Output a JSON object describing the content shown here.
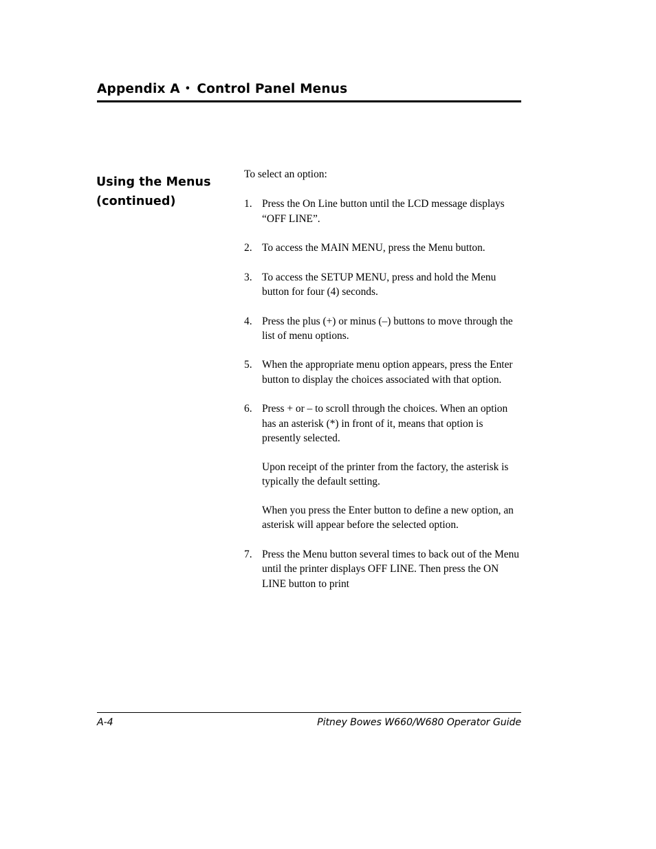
{
  "header": {
    "appendix_label": "Appendix A",
    "separator": "•",
    "title": "Control Panel Menus"
  },
  "sidebar": {
    "heading_line1": "Using the Menus",
    "heading_line2": "(continued)"
  },
  "main": {
    "lead_in": "To select an option:",
    "steps": [
      {
        "number": "1.",
        "text": "Press the On Line button until the LCD message displays “OFF LINE”."
      },
      {
        "number": "2.",
        "text": "To access the MAIN MENU, press the Menu button."
      },
      {
        "number": "3.",
        "text": "To access the SETUP MENU, press and hold the Menu button for four (4) seconds."
      },
      {
        "number": "4.",
        "text": "Press the plus (+) or minus (–) buttons to move through the list of menu options."
      },
      {
        "number": "5.",
        "text": "When the appropriate menu option appears, press the Enter button to display the choices associated with that option."
      },
      {
        "number": "6.",
        "text": "Press + or – to scroll through the choices. When an option has an asterisk (*) in front of it, means that option is presently selected.",
        "sub_paragraphs": [
          "Upon receipt of the printer from the factory, the asterisk is typically the default setting.",
          "When you press the Enter button to define a new option, an asterisk will appear before the selected option."
        ]
      },
      {
        "number": "7.",
        "text": "Press the Menu button several times to back out of the Menu until the printer displays OFF LINE.  Then press the ON LINE button to print"
      }
    ]
  },
  "footer": {
    "page_number": "A-4",
    "guide_title": "Pitney Bowes W660/W680 Operator Guide"
  },
  "colors": {
    "page_background": "#ffffff",
    "text": "#000000",
    "rule": "#000000"
  }
}
